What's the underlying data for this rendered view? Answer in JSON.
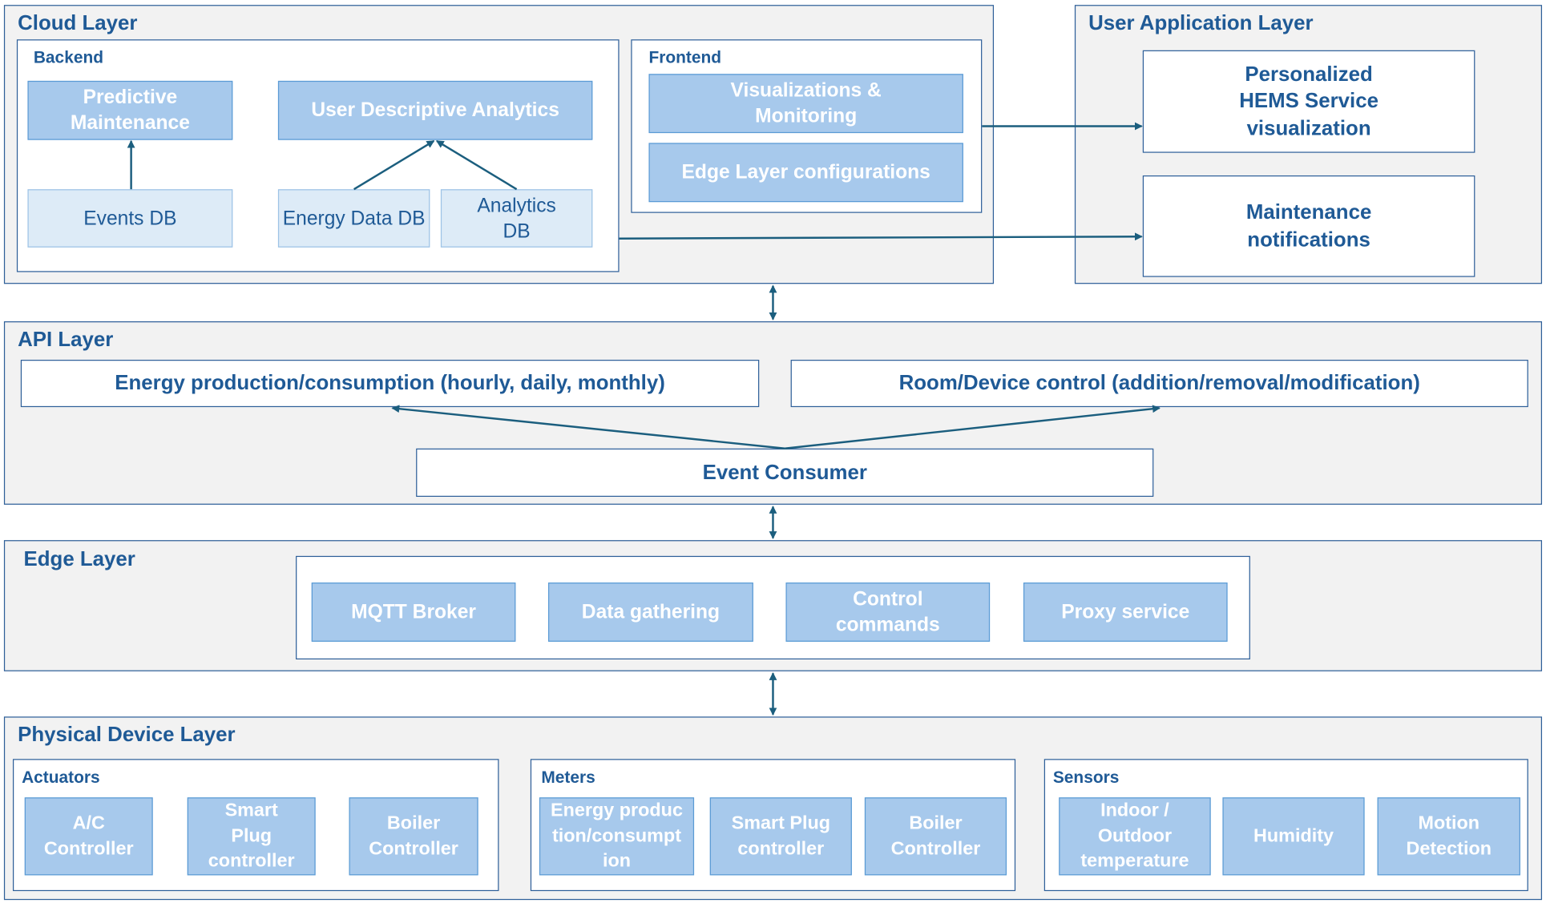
{
  "colors": {
    "layer_border": "#2e5f99",
    "title_text": "#1f5a96",
    "filled_box": "#a7c9ec",
    "filled_border": "#5b9bd5",
    "light_box": "#ddebf7",
    "arrow": "#1b5e7e",
    "layer_bg": "#f2f2f2"
  },
  "cloud": {
    "title": "Cloud Layer",
    "backend": {
      "title": "Backend",
      "predictive": "Predictive Maintenance",
      "uda": "User Descriptive Analytics",
      "events_db": "Events DB",
      "energy_db": "Energy Data DB",
      "analytics_db": "Analytics DB"
    },
    "frontend": {
      "title": "Frontend",
      "viz": "Visualizations & Monitoring",
      "edge_config": "Edge Layer configurations"
    }
  },
  "user_app": {
    "title": "User Application Layer",
    "hems": "Personalized HEMS Service visualization",
    "maintenance": "Maintenance notifications"
  },
  "api": {
    "title": "API Layer",
    "energy": "Energy production/consumption (hourly, daily, monthly)",
    "room": "Room/Device control (addition/removal/modification)",
    "event_consumer": "Event Consumer"
  },
  "edge": {
    "title": "Edge Layer",
    "items": [
      "MQTT Broker",
      "Data gathering",
      "Control commands",
      "Proxy service"
    ]
  },
  "physical": {
    "title": "Physical Device Layer",
    "actuators": {
      "title": "Actuators",
      "items": [
        "A/C Controller",
        "Smart Plug controller",
        "Boiler Controller"
      ]
    },
    "meters": {
      "title": "Meters",
      "items": [
        "Energy production/consumption",
        "Smart Plug controller",
        "Boiler Controller"
      ]
    },
    "sensors": {
      "title": "Sensors",
      "items": [
        "Indoor / Outdoor temperature",
        "Humidity",
        "Motion Detection"
      ]
    }
  }
}
